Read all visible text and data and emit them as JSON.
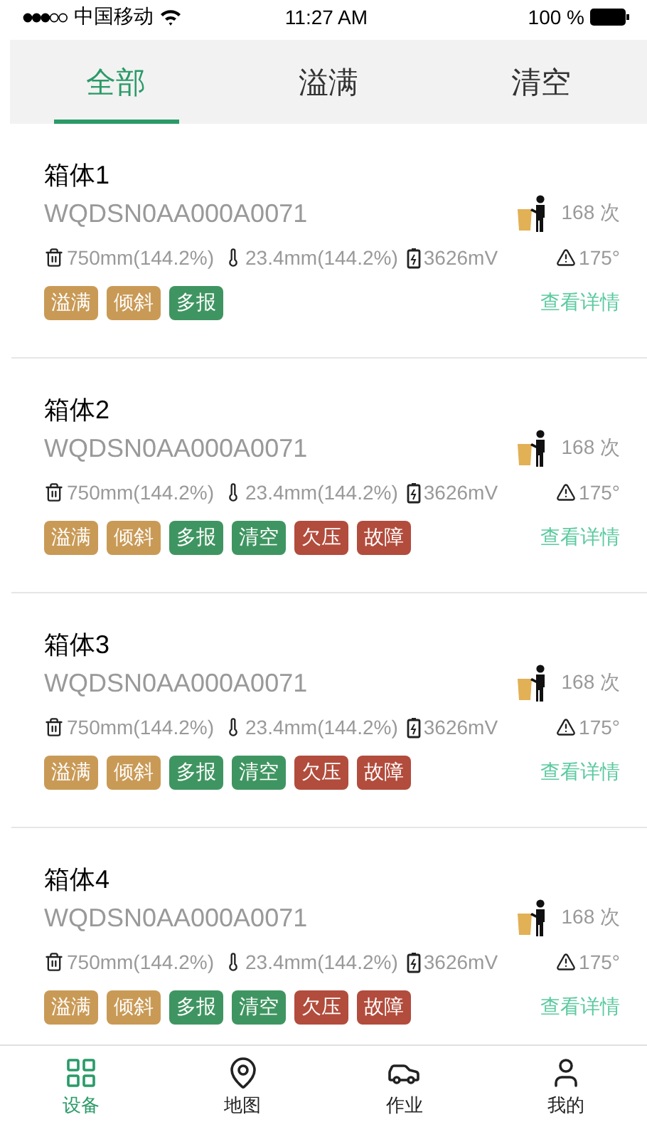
{
  "status_bar": {
    "carrier": "中国移动",
    "time": "11:27 AM",
    "battery": "100 %"
  },
  "tabs": [
    {
      "label": "全部",
      "selected": true
    },
    {
      "label": "溢满",
      "selected": false
    },
    {
      "label": "清空",
      "selected": false
    }
  ],
  "devices": [
    {
      "name": "箱体1",
      "serial": "WQDSN0AA000A0071",
      "count": "168 次",
      "metrics": [
        {
          "kind": "fill",
          "text": "750mm(144.2%)"
        },
        {
          "kind": "temperature",
          "text": "23.4mm(144.2%)"
        },
        {
          "kind": "voltage",
          "text": "3626mV"
        },
        {
          "kind": "angle",
          "text": "175°"
        }
      ],
      "tags": [
        {
          "label": "溢满",
          "color": "#c99a56"
        },
        {
          "label": "倾斜",
          "color": "#c99a56"
        },
        {
          "label": "多报",
          "color": "#3f9561"
        }
      ],
      "link": "查看详情"
    },
    {
      "name": "箱体2",
      "serial": "WQDSN0AA000A0071",
      "count": "168 次",
      "metrics": [
        {
          "kind": "fill",
          "text": "750mm(144.2%)"
        },
        {
          "kind": "temperature",
          "text": "23.4mm(144.2%)"
        },
        {
          "kind": "voltage",
          "text": "3626mV"
        },
        {
          "kind": "angle",
          "text": "175°"
        }
      ],
      "tags": [
        {
          "label": "溢满",
          "color": "#c99a56"
        },
        {
          "label": "倾斜",
          "color": "#c99a56"
        },
        {
          "label": "多报",
          "color": "#3f9561"
        },
        {
          "label": "清空",
          "color": "#3f9561"
        },
        {
          "label": "欠压",
          "color": "#b24c3c"
        },
        {
          "label": "故障",
          "color": "#b24c3c"
        }
      ],
      "link": "查看详情"
    },
    {
      "name": "箱体3",
      "serial": "WQDSN0AA000A0071",
      "count": "168 次",
      "metrics": [
        {
          "kind": "fill",
          "text": "750mm(144.2%)"
        },
        {
          "kind": "temperature",
          "text": "23.4mm(144.2%)"
        },
        {
          "kind": "voltage",
          "text": "3626mV"
        },
        {
          "kind": "angle",
          "text": "175°"
        }
      ],
      "tags": [
        {
          "label": "溢满",
          "color": "#c99a56"
        },
        {
          "label": "倾斜",
          "color": "#c99a56"
        },
        {
          "label": "多报",
          "color": "#3f9561"
        },
        {
          "label": "清空",
          "color": "#3f9561"
        },
        {
          "label": "欠压",
          "color": "#b24c3c"
        },
        {
          "label": "故障",
          "color": "#b24c3c"
        }
      ],
      "link": "查看详情"
    },
    {
      "name": "箱体4",
      "serial": "WQDSN0AA000A0071",
      "count": "168 次",
      "metrics": [
        {
          "kind": "fill",
          "text": "750mm(144.2%)"
        },
        {
          "kind": "temperature",
          "text": "23.4mm(144.2%)"
        },
        {
          "kind": "voltage",
          "text": "3626mV"
        },
        {
          "kind": "angle",
          "text": "175°"
        }
      ],
      "tags": [
        {
          "label": "溢满",
          "color": "#c99a56"
        },
        {
          "label": "倾斜",
          "color": "#c99a56"
        },
        {
          "label": "多报",
          "color": "#3f9561"
        },
        {
          "label": "清空",
          "color": "#3f9561"
        },
        {
          "label": "欠压",
          "color": "#b24c3c"
        },
        {
          "label": "故障",
          "color": "#b24c3c"
        }
      ],
      "link": "查看详情"
    }
  ],
  "nav": [
    {
      "kind": "devices",
      "label": "设备",
      "selected": true
    },
    {
      "kind": "map",
      "label": "地图",
      "selected": false
    },
    {
      "kind": "work",
      "label": "作业",
      "selected": false
    },
    {
      "kind": "mine",
      "label": "我的",
      "selected": false
    }
  ]
}
